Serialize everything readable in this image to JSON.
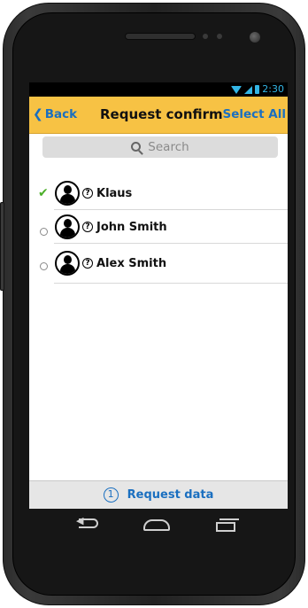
{
  "status_bar": {
    "time": "2:30"
  },
  "title_bar": {
    "back_label": "Back",
    "title": "Request confirm",
    "select_all_label": "Select All"
  },
  "search": {
    "placeholder": "Search"
  },
  "contacts": [
    {
      "name": "Klaus",
      "selected": true
    },
    {
      "name": "John Smith",
      "selected": false
    },
    {
      "name": "Alex Smith",
      "selected": false
    }
  ],
  "bottom_bar": {
    "count": "1",
    "label": "Request data"
  },
  "colors": {
    "accent": "#f7c244",
    "link": "#1a6fc0",
    "check": "#4caf2a",
    "status": "#33b5e5"
  },
  "icons": [
    "back-chevron-icon",
    "search-icon",
    "check-icon",
    "radio-icon",
    "avatar-icon",
    "question-icon",
    "nav-back-icon",
    "nav-home-icon",
    "nav-recent-icon"
  ]
}
